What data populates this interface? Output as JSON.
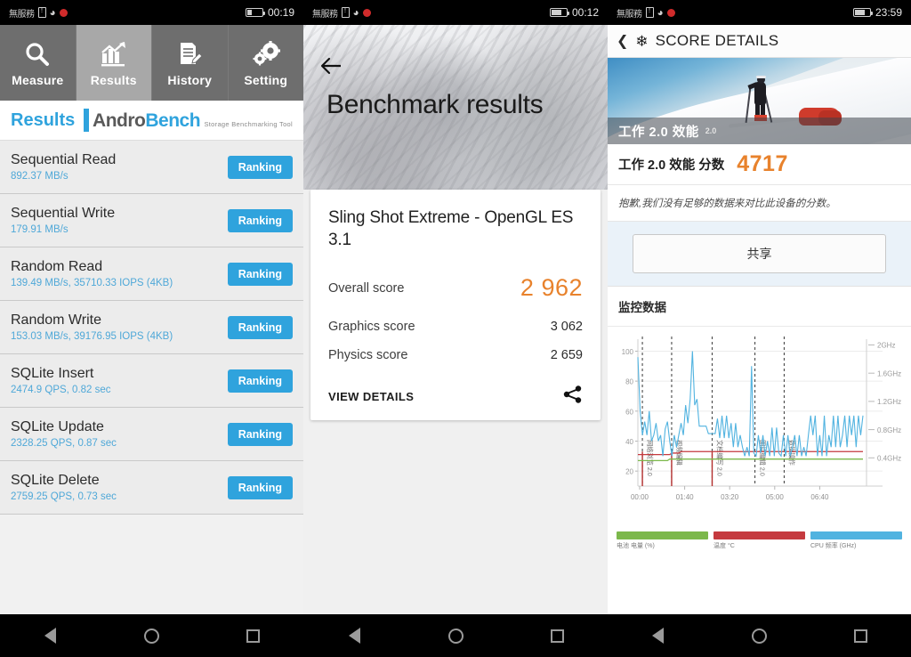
{
  "panel_androbench": {
    "status_bar": {
      "carrier": "無服務",
      "time": "00:19",
      "icons": [
        "sim-card-icon",
        "wifi-icon",
        "recording-icon",
        "battery-icon"
      ]
    },
    "tabs": [
      {
        "label": "Measure",
        "icon": "magnifier-icon",
        "active": false
      },
      {
        "label": "Results",
        "icon": "bar-chart-icon",
        "active": true
      },
      {
        "label": "History",
        "icon": "document-pen-icon",
        "active": false
      },
      {
        "label": "Setting",
        "icon": "gears-icon",
        "active": false
      }
    ],
    "header": {
      "title": "Results",
      "logo_main_a": "Andro",
      "logo_main_b": "Bench",
      "logo_sub": "Storage Benchmarking Tool"
    },
    "rank_button_label": "Ranking",
    "rows": [
      {
        "title": "Sequential Read",
        "value": "892.37 MB/s"
      },
      {
        "title": "Sequential Write",
        "value": "179.91 MB/s"
      },
      {
        "title": "Random Read",
        "value": "139.49 MB/s, 35710.33 IOPS (4KB)"
      },
      {
        "title": "Random Write",
        "value": "153.03 MB/s, 39176.95 IOPS (4KB)"
      },
      {
        "title": "SQLite Insert",
        "value": "2474.9 QPS, 0.82 sec"
      },
      {
        "title": "SQLite Update",
        "value": "2328.25 QPS, 0.87 sec"
      },
      {
        "title": "SQLite Delete",
        "value": "2759.25 QPS, 0.73 sec"
      }
    ]
  },
  "panel_3dmark": {
    "status_bar": {
      "carrier": "無服務",
      "time": "00:12"
    },
    "back_icon": "back-arrow-icon",
    "title": "Benchmark results",
    "card": {
      "title": "Sling Shot Extreme - OpenGL ES 3.1",
      "rows": [
        {
          "label": "Overall score",
          "value": "2 962"
        },
        {
          "label": "Graphics score",
          "value": "3 062"
        },
        {
          "label": "Physics score",
          "value": "2 659"
        }
      ],
      "details_label": "VIEW DETAILS",
      "share_icon": "share-icon",
      "accent_color": "#e8822c"
    }
  },
  "panel_pcmark": {
    "status_bar": {
      "carrier": "無服務",
      "time": "23:59"
    },
    "appbar": {
      "back_icon": "back-chevron-icon",
      "app_icon": "snowflake-icon",
      "title": "SCORE DETAILS"
    },
    "banner": {
      "label": "工作 2.0 效能",
      "superscript": "2.0"
    },
    "score": {
      "label": "工作 2.0 效能 分数",
      "value": "4717",
      "color": "#e8822c"
    },
    "note": "抱歉,我们没有足够的数据来对比此设备的分数。",
    "share_label": "共享",
    "section_title": "监控数据",
    "legend": [
      {
        "label": "电池 电量 (%)",
        "color": "#7cb84b"
      },
      {
        "label": "温度 °C",
        "color": "#c53a3f"
      },
      {
        "label": "CPU 频率 (GHz)",
        "color": "#51b3e0"
      }
    ],
    "chart_data": {
      "type": "line",
      "title": "监控数据",
      "xlabel": "",
      "ylabel": "",
      "x_ticks": [
        "00:00",
        "01:40",
        "03:20",
        "05:00",
        "06:40"
      ],
      "y_left_ticks": [
        20,
        40,
        60,
        80,
        100
      ],
      "y_left_range": [
        10,
        108
      ],
      "y_right_ticks": [
        "0.4GHz",
        "0.8GHz",
        "1.2GHz",
        "1.6GHz",
        "2GHz"
      ],
      "y_right_range": [
        0,
        2.2
      ],
      "grid": true,
      "legend_position": "bottom",
      "annotations": [
        {
          "label": "网络浏览 2.0",
          "x_pct": 2
        },
        {
          "label": "视频编辑",
          "x_pct": 15
        },
        {
          "label": "文档编写 2.0",
          "x_pct": 33
        },
        {
          "label": "图片编辑 2.0",
          "x_pct": 52
        },
        {
          "label": "数据操作",
          "x_pct": 65
        }
      ],
      "series": [
        {
          "name": "电池 电量 (%)",
          "color": "#7cb84b",
          "axis": "left",
          "values": [
            27,
            27,
            27,
            27,
            27,
            27,
            27,
            27,
            27,
            27,
            27,
            27,
            27,
            27,
            28,
            28,
            28,
            28,
            28,
            28,
            28,
            28,
            28,
            28,
            28,
            28,
            28,
            28,
            28,
            28,
            28,
            28,
            28,
            28,
            28,
            28,
            28,
            28,
            28,
            28,
            28,
            28,
            28,
            28,
            28,
            28,
            28,
            28,
            28,
            28,
            28,
            28,
            28,
            28,
            28,
            28,
            28,
            28,
            28,
            28,
            28,
            28,
            28,
            28,
            28,
            28,
            28,
            28,
            28,
            28,
            28,
            28,
            28,
            28,
            28,
            28,
            28,
            28,
            28,
            28,
            28,
            28,
            28,
            28,
            28,
            28,
            28,
            28,
            28,
            28,
            28,
            28,
            28,
            28,
            28,
            28,
            28,
            28,
            28,
            28
          ]
        },
        {
          "name": "温度 °C",
          "color": "#c53a3f",
          "axis": "left",
          "values": [
            31,
            31,
            31,
            31,
            31,
            31,
            31,
            31,
            31,
            31,
            31,
            31,
            31,
            31,
            31,
            32,
            32,
            32,
            32,
            33,
            33,
            33,
            33,
            33,
            33,
            33,
            33,
            33,
            33,
            33,
            33,
            33,
            33,
            33,
            33,
            33,
            33,
            33,
            33,
            33,
            33,
            33,
            33,
            33,
            33,
            33,
            33,
            33,
            33,
            33,
            33,
            33,
            33,
            33,
            33,
            33,
            33,
            33,
            33,
            33,
            33,
            33,
            33,
            33,
            33,
            33,
            33,
            33,
            33,
            33,
            33,
            33,
            33,
            33,
            33,
            33,
            33,
            33,
            33,
            33,
            33,
            33,
            33,
            33,
            33,
            33,
            33,
            33,
            33,
            33,
            33,
            33,
            33,
            33,
            33,
            33,
            33,
            33,
            33,
            33
          ]
        },
        {
          "name": "CPU 频率 (GHz)",
          "color": "#51b3e0",
          "axis": "right",
          "values": [
            96,
            60,
            44,
            53,
            44,
            60,
            40,
            44,
            52,
            40,
            44,
            30,
            48,
            53,
            40,
            30,
            44,
            36,
            44,
            52,
            44,
            64,
            52,
            68,
            100,
            64,
            68,
            50,
            50,
            50,
            50,
            45,
            45,
            45,
            45,
            55,
            42,
            57,
            42,
            57,
            42,
            52,
            36,
            52,
            36,
            44,
            36,
            30,
            36,
            30,
            90,
            32,
            30,
            44,
            32,
            44,
            30,
            40,
            30,
            49,
            30,
            49,
            32,
            30,
            44,
            30,
            44,
            30,
            36,
            44,
            30,
            44,
            30,
            36,
            30,
            44,
            57,
            44,
            57,
            30,
            44,
            30,
            57,
            30,
            44,
            36,
            57,
            36,
            57,
            36,
            44,
            57,
            36,
            57,
            44,
            57,
            36,
            57,
            44,
            57
          ]
        }
      ]
    }
  }
}
